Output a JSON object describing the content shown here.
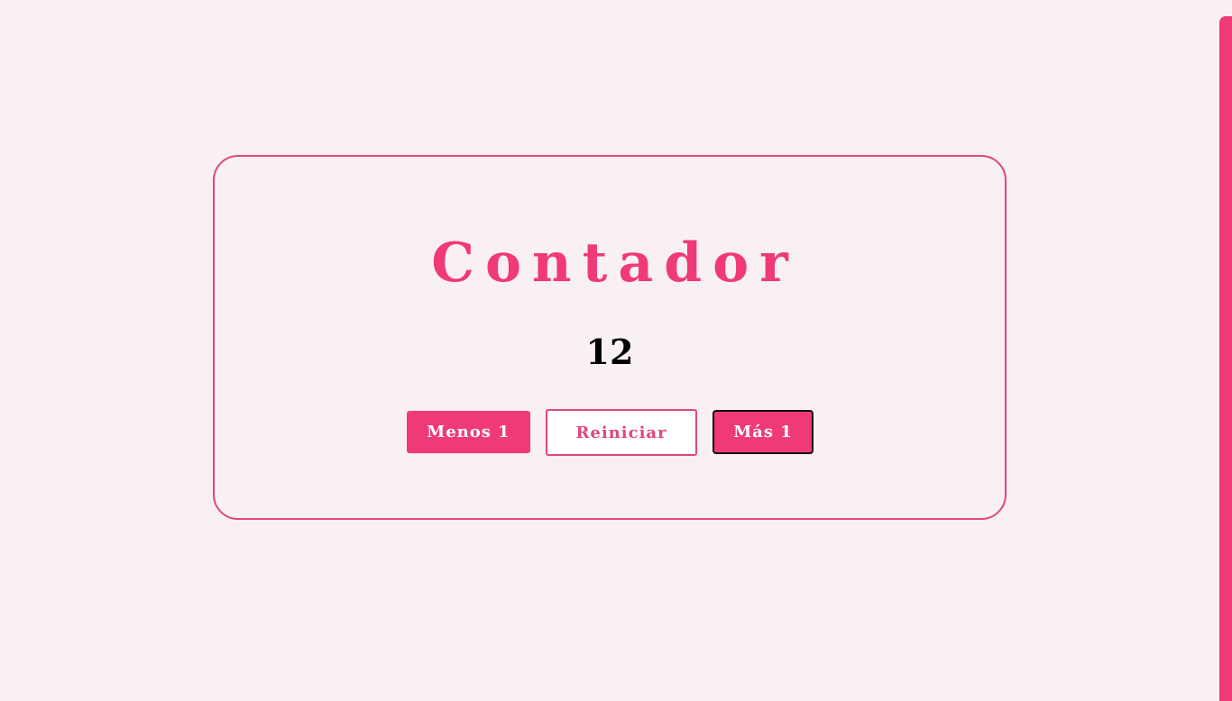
{
  "counter": {
    "title": "Contador",
    "value": "12"
  },
  "buttons": {
    "minus_label": "Menos 1",
    "reset_label": "Reiniciar",
    "plus_label": "Más 1"
  },
  "colors": {
    "accent": "#f03a78",
    "border": "#e0487a",
    "background": "#f8f0f4"
  }
}
